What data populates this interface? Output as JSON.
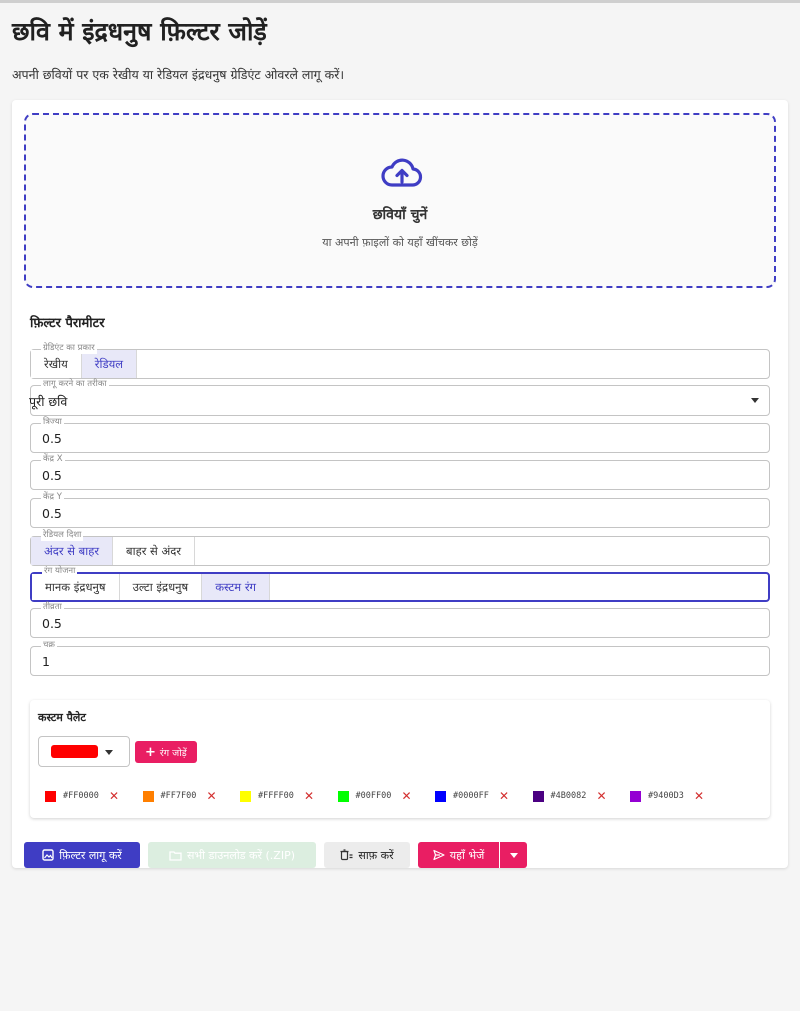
{
  "page": {
    "title": "छवि में इंद्रधनुष फ़िल्टर जोड़ें",
    "subtitle": "अपनी छवियों पर एक रेखीय या रेडियल इंद्रधनुष ग्रेडिएंट ओवरले लागू करें।"
  },
  "dropzone": {
    "icon": "cloud-upload-icon",
    "title": "छवियाँ चुनें",
    "subtitle": "या अपनी फ़ाइलों को यहाँ खींचकर छोड़ें"
  },
  "params": {
    "section_title": "फ़िल्टर पैरामीटर",
    "gradient_type": {
      "label": "ग्रेडिएंट का प्रकार",
      "options": [
        "रेखीय",
        "रेडियल"
      ],
      "selected": "रेडियल"
    },
    "apply_method": {
      "label": "लागू करने का तरीका",
      "value": "पूरी छवि"
    },
    "radius": {
      "label": "त्रिज्या",
      "value": "0.5"
    },
    "center_x": {
      "label": "केंद्र X",
      "value": "0.5"
    },
    "center_y": {
      "label": "केंद्र Y",
      "value": "0.5"
    },
    "radial_direction": {
      "label": "रेडियल दिशा",
      "options": [
        "अंदर से बाहर",
        "बाहर से अंदर"
      ],
      "selected": "अंदर से बाहर"
    },
    "color_scheme": {
      "label": "रंग योजना",
      "options": [
        "मानक इंद्रधनुष",
        "उल्टा इंद्रधनुष",
        "कस्टम रंग"
      ],
      "selected": "कस्टम रंग"
    },
    "intensity": {
      "label": "तीव्रता",
      "value": "0.5"
    },
    "cycles": {
      "label": "चक्र",
      "value": "1"
    }
  },
  "palette": {
    "title": "कस्टम पैलेट",
    "picker_color": "#FF0000",
    "add_label": "रंग जोड़ें",
    "colors": [
      "#FF0000",
      "#FF7F00",
      "#FFFF00",
      "#00FF00",
      "#0000FF",
      "#4B0082",
      "#9400D3"
    ]
  },
  "actions": {
    "apply": "फ़िल्टर लागू करें",
    "download_all": "सभी डाउनलोड करें (.ZIP)",
    "clear": "साफ़ करें",
    "send": "यहाँ भेजें"
  },
  "colors": {
    "primary": "#3F3DC4",
    "accent": "#E91E63",
    "download_disabled": "#DCEEE0",
    "remove": "#D32F2F"
  }
}
